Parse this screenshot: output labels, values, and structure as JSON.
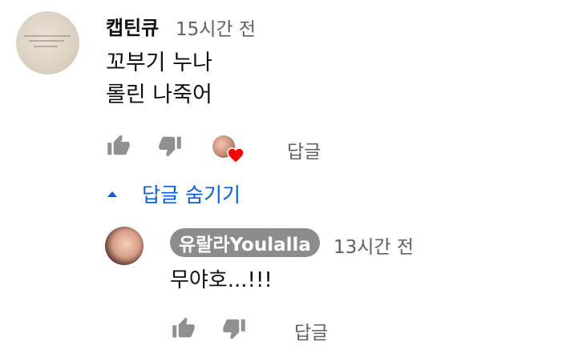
{
  "comment": {
    "author": "캡틴큐",
    "time": "15시간 전",
    "text": "꼬부기 누나\n롤린 나죽어",
    "reply_label": "답글",
    "toggle_label": "답글 숨기기"
  },
  "reply": {
    "author": "유랄라Youlalla",
    "time": "13시간 전",
    "text": "무야호...!!!",
    "reply_label": "답글"
  },
  "colors": {
    "link_blue": "#065fd4",
    "meta_gray": "#606060",
    "icon_gray": "#909090",
    "chip_bg": "#8c8c8c",
    "heart_red": "#ff0000"
  },
  "icons": [
    "thumb-up-icon",
    "thumb-down-icon",
    "creator-heart-icon",
    "caret-up-icon"
  ]
}
